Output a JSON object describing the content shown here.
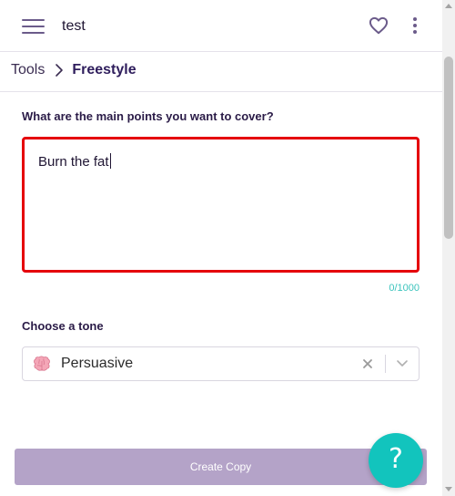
{
  "header": {
    "menu_icon": "hamburger-menu-icon",
    "project_name": "test",
    "favorite_icon": "heart-icon",
    "more_icon": "vertical-ellipsis-icon"
  },
  "breadcrumb": {
    "parent": "Tools",
    "separator_icon": "chevron-right-icon",
    "current": "Freestyle"
  },
  "form": {
    "main_points": {
      "label": "What are the main points you want to cover?",
      "value": "Burn the fat",
      "char_count": "0/1000"
    },
    "tone": {
      "label": "Choose a tone",
      "icon": "brain-emoji",
      "selected": "Persuasive",
      "clear_icon": "close-x-icon",
      "dropdown_icon": "chevron-down-icon"
    },
    "submit_label": "Create Copy"
  },
  "help": {
    "label": "?"
  },
  "colors": {
    "accent_purple": "#2e1d5c",
    "button_disabled": "#b4a3c8",
    "focus_border": "#e5000b",
    "teal": "#12c4bd"
  }
}
